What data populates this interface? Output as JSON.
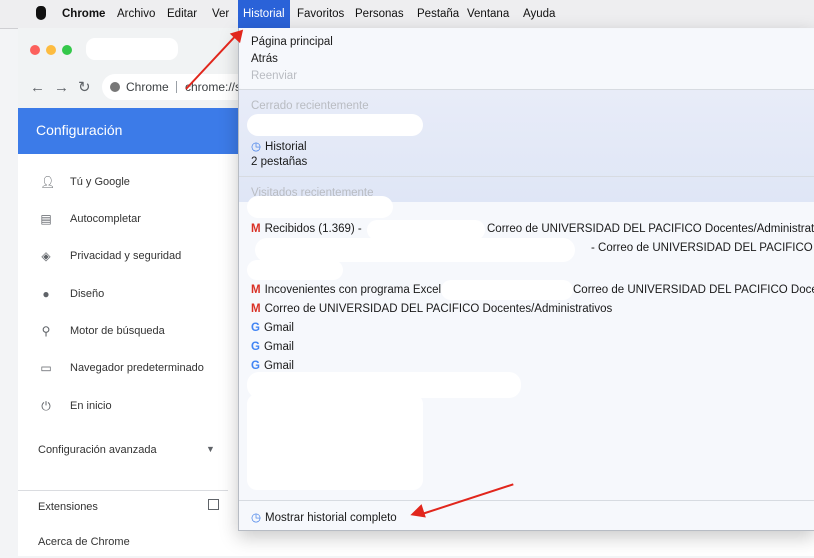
{
  "menubar": {
    "app": "Chrome",
    "items": [
      "Archivo",
      "Editar",
      "Ver",
      "Historial",
      "Favoritos",
      "Personas",
      "Pestaña",
      "Ventana",
      "Ayuda"
    ]
  },
  "browser": {
    "omnibox_label": "Chrome",
    "omnibox_url": "chrome://s"
  },
  "settings": {
    "title": "Configuración",
    "sidebar": [
      {
        "label": "Tú y Google",
        "icon": "person-icon"
      },
      {
        "label": "Autocompletar",
        "icon": "clipboard-icon"
      },
      {
        "label": "Privacidad y seguridad",
        "icon": "shield-icon"
      },
      {
        "label": "Diseño",
        "icon": "palette-icon"
      },
      {
        "label": "Motor de búsqueda",
        "icon": "search-icon"
      },
      {
        "label": "Navegador predeterminado",
        "icon": "browser-icon"
      },
      {
        "label": "En inicio",
        "icon": "power-icon"
      }
    ],
    "advanced": "Configuración avanzada",
    "extensions": "Extensiones",
    "about": "Acerca de Chrome"
  },
  "history_menu": {
    "home": "Página principal",
    "back": "Atrás",
    "forward": "Reenviar",
    "recently_closed": "Cerrado recientemente",
    "history": "Historial",
    "tabs": "2 pestañas",
    "recently_visited": "Visitados recientemente",
    "entries": {
      "recibidos": "Recibidos (1.369) -",
      "correo_1": "Correo de UNIVERSIDAD DEL PACIFICO Docentes/Administrativos",
      "correo_2": "- Correo de UNIVERSIDAD DEL PACIFICO Doc",
      "inconvenientes": "Incovenientes con programa Excel",
      "correo_3": "Correo de UNIVERSIDAD DEL PACIFICO Docentes",
      "correo_4": "Correo de UNIVERSIDAD DEL PACIFICO Docentes/Administrativos",
      "gmail": "Gmail"
    },
    "show_full": "Mostrar historial completo"
  },
  "colors": {
    "accent": "#3c7be8",
    "menu_highlight": "#2a62d8",
    "annotation": "#e1261c"
  }
}
